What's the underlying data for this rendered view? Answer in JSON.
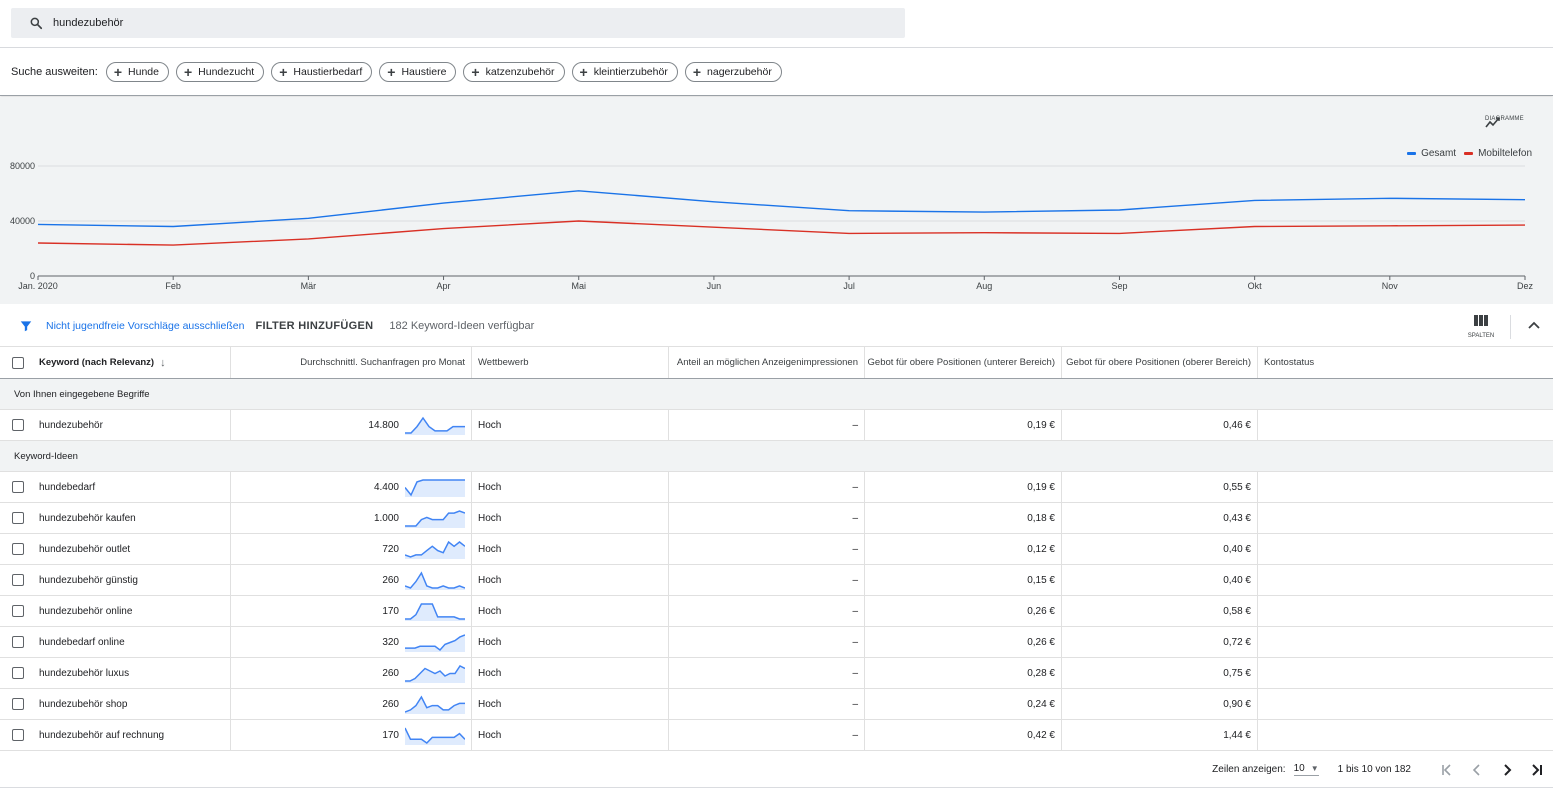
{
  "search": {
    "query": "hundezubehör"
  },
  "broaden": {
    "label": "Suche ausweiten:",
    "chips": [
      "Hunde",
      "Hundezucht",
      "Haustierbedarf",
      "Haustiere",
      "katzenzubehör",
      "kleintierzubehör",
      "nagerzubehör"
    ]
  },
  "chart_toggle": {
    "label": "DIAGRAMME",
    "icon": "trend-line-icon"
  },
  "chart_data": {
    "type": "line",
    "x": [
      "Jan. 2020",
      "Feb",
      "Mär",
      "Apr",
      "Mai",
      "Jun",
      "Jul",
      "Aug",
      "Sep",
      "Okt",
      "Nov",
      "Dez"
    ],
    "series": [
      {
        "name": "Gesamt",
        "color": "#1a73e8",
        "values": [
          37500,
          36000,
          42000,
          53000,
          62000,
          54000,
          47500,
          46500,
          48000,
          55000,
          56500,
          55500
        ]
      },
      {
        "name": "Mobiltelefon",
        "color": "#d93025",
        "values": [
          24000,
          22500,
          27000,
          34500,
          40000,
          35500,
          31000,
          31500,
          31000,
          36000,
          36500,
          37000
        ]
      }
    ],
    "yticks": [
      "0",
      "40000",
      "80000"
    ],
    "ylim": [
      0,
      80000
    ],
    "grid": true,
    "legend": "top-right"
  },
  "filters": {
    "icon": "filter-icon",
    "exclude_adult": "Nicht jugendfreie Vorschläge ausschließen",
    "add_filter": "FILTER HINZUFÜGEN",
    "count": "182 Keyword-Ideen verfügbar",
    "columns_label": "SPALTEN"
  },
  "table": {
    "headers": {
      "keyword": "Keyword (nach Relevanz)",
      "avg": "Durchschnittl. Suchanfragen pro Monat",
      "competition": "Wettbewerb",
      "share": "Anteil an möglichen Anzeigenimpressionen",
      "bid_low": "Gebot für obere Positionen (unterer Bereich)",
      "bid_high": "Gebot für obere Positionen (oberer Bereich)",
      "status": "Kontostatus"
    },
    "group_entered": "Von Ihnen eingegebene Begriffe",
    "group_ideas": "Keyword-Ideen",
    "entered_rows": [
      {
        "keyword": "hundezubehör",
        "avg": "14.800",
        "competition": "Hoch",
        "share": "–",
        "low": "0,19 €",
        "high": "0,46 €",
        "trend": [
          2,
          2,
          5,
          9,
          5,
          3,
          3,
          3,
          5,
          5,
          5
        ]
      }
    ],
    "idea_rows": [
      {
        "keyword": "hundebedarf",
        "avg": "4.400",
        "competition": "Hoch",
        "share": "–",
        "low": "0,19 €",
        "high": "0,55 €",
        "trend": [
          5,
          1,
          8,
          9,
          9,
          9,
          9,
          9,
          9,
          9,
          9
        ]
      },
      {
        "keyword": "hundezubehör kaufen",
        "avg": "1.000",
        "competition": "Hoch",
        "share": "–",
        "low": "0,18 €",
        "high": "0,43 €",
        "trend": [
          1,
          1,
          1,
          4,
          5,
          4,
          4,
          4,
          7,
          7,
          8,
          7
        ]
      },
      {
        "keyword": "hundezubehör outlet",
        "avg": "720",
        "competition": "Hoch",
        "share": "–",
        "low": "0,12 €",
        "high": "0,40 €",
        "trend": [
          2,
          1,
          2,
          2,
          4,
          6,
          4,
          3,
          8,
          6,
          8,
          6
        ]
      },
      {
        "keyword": "hundezubehör günstig",
        "avg": "260",
        "competition": "Hoch",
        "share": "–",
        "low": "0,15 €",
        "high": "0,40 €",
        "trend": [
          3,
          2,
          5,
          9,
          3,
          2,
          2,
          3,
          2,
          2,
          3,
          2
        ]
      },
      {
        "keyword": "hundezubehör online",
        "avg": "170",
        "competition": "Hoch",
        "share": "–",
        "low": "0,26 €",
        "high": "0,58 €",
        "trend": [
          1,
          1,
          3,
          8,
          8,
          8,
          2,
          2,
          2,
          2,
          1,
          1
        ]
      },
      {
        "keyword": "hundebedarf online",
        "avg": "320",
        "competition": "Hoch",
        "share": "–",
        "low": "0,26 €",
        "high": "0,72 €",
        "trend": [
          2,
          2,
          2,
          3,
          3,
          3,
          3,
          1,
          4,
          5,
          6,
          8,
          9
        ]
      },
      {
        "keyword": "hundezubehör luxus",
        "avg": "260",
        "competition": "Hoch",
        "share": "–",
        "low": "0,28 €",
        "high": "0,75 €",
        "trend": [
          2,
          2,
          3,
          5,
          7,
          6,
          5,
          6,
          4,
          5,
          5,
          8,
          7
        ]
      },
      {
        "keyword": "hundezubehör shop",
        "avg": "260",
        "competition": "Hoch",
        "share": "–",
        "low": "0,24 €",
        "high": "0,90 €",
        "trend": [
          2,
          3,
          5,
          9,
          4,
          5,
          5,
          3,
          3,
          5,
          6,
          6
        ]
      },
      {
        "keyword": "hundezubehör auf rechnung",
        "avg": "170",
        "competition": "Hoch",
        "share": "–",
        "low": "0,42 €",
        "high": "1,44 €",
        "trend": [
          9,
          3,
          3,
          3,
          1,
          4,
          4,
          4,
          4,
          4,
          6,
          3
        ]
      }
    ]
  },
  "pager": {
    "rows_label": "Zeilen anzeigen:",
    "rows_value": "10",
    "range": "1 bis 10 von 182"
  }
}
